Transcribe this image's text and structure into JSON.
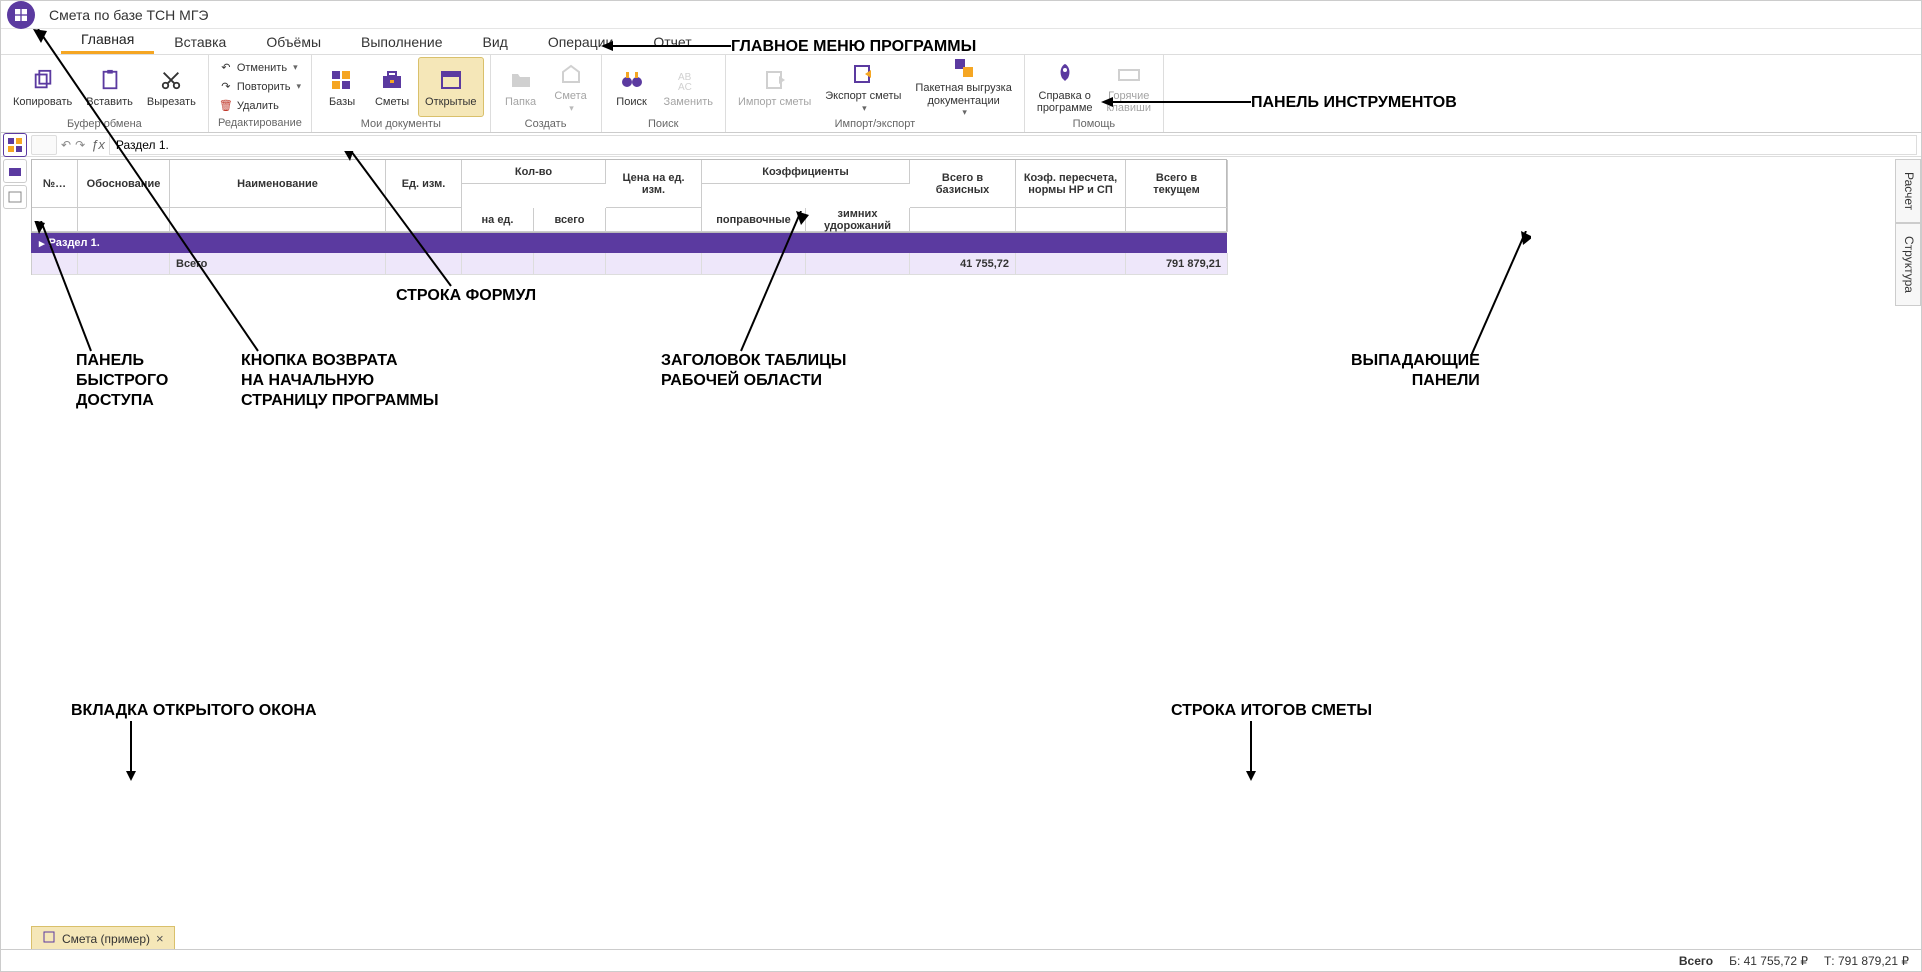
{
  "title": "Смета по базе ТСН МГЭ",
  "menu": {
    "items": [
      "Главная",
      "Вставка",
      "Объёмы",
      "Выполнение",
      "Вид",
      "Операции",
      "Отчет"
    ],
    "active": 0
  },
  "ribbon": {
    "clipboard": {
      "copy": "Копировать",
      "paste": "Вставить",
      "cut": "Вырезать",
      "group": "Буфер обмена"
    },
    "edit": {
      "undo": "Отменить",
      "redo": "Повторить",
      "delete": "Удалить",
      "group": "Редактирование"
    },
    "myDocs": {
      "bases": "Базы",
      "estimates": "Сметы",
      "open": "Открытые",
      "group": "Мои документы"
    },
    "create": {
      "folder": "Папка",
      "estimate": "Смета",
      "group": "Создать"
    },
    "search": {
      "find": "Поиск",
      "replace": "Заменить",
      "group": "Поиск"
    },
    "impexp": {
      "import": "Импорт сметы",
      "export": "Экспорт сметы",
      "batch": "Пакетная выгрузка\nдокументации",
      "group": "Импорт/экспорт"
    },
    "help": {
      "about": "Справка о\nпрограмме",
      "hotkeys": "Горячие\nклавиши",
      "group": "Помощь"
    }
  },
  "formula": {
    "value": "Раздел 1."
  },
  "table": {
    "headers": {
      "num": "№…",
      "basis": "Обоснование",
      "name": "Наименование",
      "unit": "Ед. изм.",
      "qty": "Кол-во",
      "qtyPer": "на ед.",
      "qtyTotal": "всего",
      "pricePer": "Цена на ед.\nизм.",
      "coeff": "Коэффициенты",
      "coeffAdj": "поправочные",
      "coeffWinter": "зимних\nудорожаний",
      "totalBase": "Всего в\nбазисных",
      "recalc": "Коэф. пересчета,\nнормы НР и СП",
      "totalCur": "Всего в\nтекущем"
    },
    "section": "Раздел 1.",
    "totalLabel": "Всего",
    "totalBase": "41 755,72",
    "totalCur": "791 879,21"
  },
  "bottomTab": {
    "label": "Смета (пример)"
  },
  "sideTabs": [
    "Расчет",
    "Структура"
  ],
  "status": {
    "label": "Всего",
    "base": "Б: 41 755,72 ₽",
    "cur": "Т: 791 879,21 ₽"
  },
  "annotations": {
    "mainMenu": "ГЛАВНОЕ МЕНЮ ПРОГРАММЫ",
    "toolbar": "ПАНЕЛЬ ИНСТРУМЕНТОВ",
    "formulaBar": "СТРОКА ФОРМУЛ",
    "quickPanel": "ПАНЕЛЬ\nБЫСТРОГО\nДОСТУПА",
    "homeBtn": "КНОПКА ВОЗВРАТА\nНА НАЧАЛЬНУЮ\nСТРАНИЦУ ПРОГРАММЫ",
    "tableHeader": "ЗАГОЛОВОК ТАБЛИЦЫ\nРАБОЧЕЙ ОБЛАСТИ",
    "dropPanels": "ВЫПАДАЮЩИЕ\nПАНЕЛИ",
    "openTab": "ВКЛАДКА ОТКРЫТОГО ОКОНА",
    "totalsRow": "СТРОКА ИТОГОВ СМЕТЫ"
  }
}
